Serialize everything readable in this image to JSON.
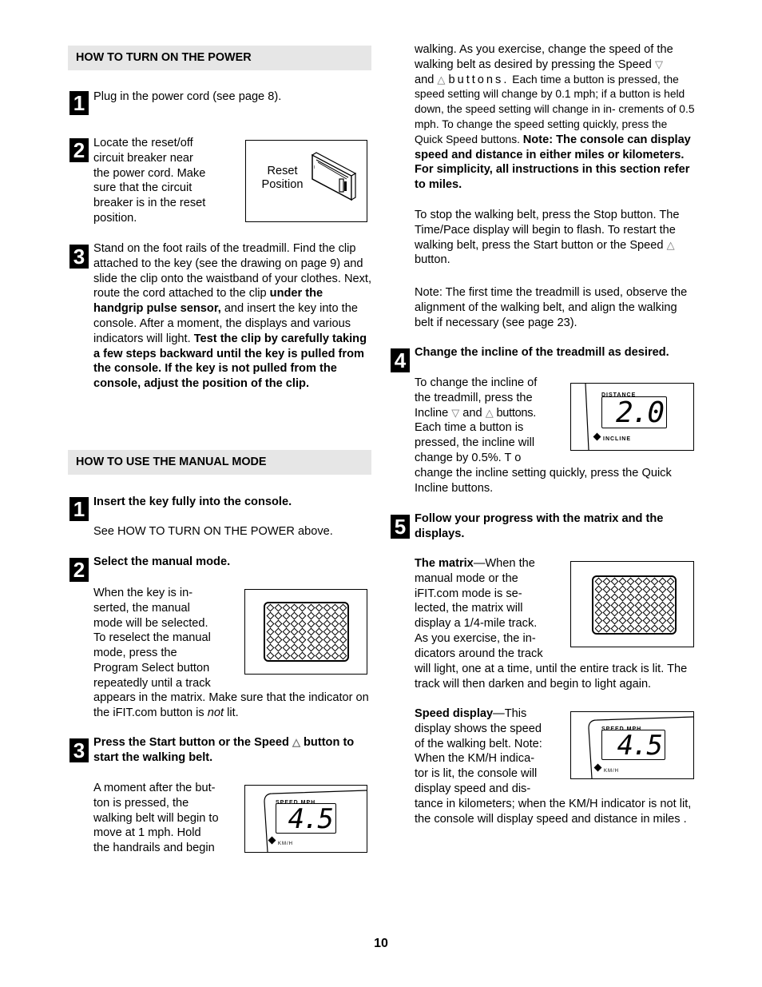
{
  "page_number": "10",
  "left": {
    "power": {
      "heading": "HOW TO TURN ON THE POWER",
      "steps": [
        {
          "n": "1",
          "text": "Plug in the power cord (see page 8)."
        },
        {
          "n": "2",
          "text_lines": [
            "Locate the reset/off",
            "circuit breaker near",
            "the power cord. Make",
            "sure that the circuit",
            "breaker is in the reset",
            "position."
          ],
          "figure": {
            "label_line1": "Reset",
            "label_line2": "Position",
            "icon": "circuit-breaker-icon"
          }
        },
        {
          "n": "3",
          "normal1": "Stand on the foot rails of the treadmill. Find the clip attached to the key (see the drawing on page 9) and slide the clip onto the waistband of your clothes. Next, route the cord attached to the clip ",
          "bold1": "under the handgrip pulse sensor,",
          "normal2": " and insert the key into the console. After a moment, the displays and various indicators will light. ",
          "bold2": "Test the clip by carefully taking a few steps backward until the key is pulled from the console. If the key is not pulled from the console, adjust the position of the clip."
        }
      ]
    },
    "manual": {
      "heading": "HOW TO USE THE MANUAL MODE",
      "steps": [
        {
          "n": "1",
          "title": "Insert the key fully into the console.",
          "text": "See HOW TO TURN ON THE POWER above."
        },
        {
          "n": "2",
          "title": "Select the manual mode.",
          "text_lines": [
            "When the key is in-",
            "serted, the manual",
            "mode will be selected.",
            "To reselect the manual",
            "mode, press the",
            "Program Select button",
            "repeatedly until a track"
          ],
          "text_tail_before": "appears in the matrix. Make sure that the indicator on the iFIT.com button is ",
          "text_tail_italic": "not",
          "text_tail_after": " lit."
        },
        {
          "n": "3",
          "title_before": "Press the Start button or the Speed ",
          "title_arrow": "△",
          "title_after": " button to start the walking belt.",
          "text_lines": [
            "A moment after the but-",
            "ton is pressed, the",
            "walking belt will begin to",
            "move at 1 mph. Hold",
            "the handrails and begin"
          ],
          "display": {
            "label": "SPEED MPH",
            "value": "4.5",
            "indicator": "KM/H"
          }
        }
      ]
    }
  },
  "right": {
    "cont_lines": [
      "walking. As you exercise, change the speed of the",
      "walking belt as desired by pressing the Speed "
    ],
    "arrow_down": "▽",
    "arrow_up": "△",
    "and_word": "and ",
    "buttons_spaced": "buttons.",
    "cont_rest": " Each time a button is pressed, the speed setting will change by 0.1 mph; if a button is held down, the speed setting will change in in- crements of 0.5 mph. To change the speed setting quickly, press the Quick Speed buttons. ",
    "cont_bold": "Note: The console can display speed and distance in either miles or kilometers. For simplicity, all instructions in this section refer to miles.",
    "stop_para_before": "To stop the walking belt, press the Stop button. The Time/Pace display will begin to flash. To restart the walking belt, press the Start button or the Speed ",
    "stop_para_after": " button.",
    "note_para": "Note: The first time the treadmill is used, observe the alignment of the walking belt, and align the walking belt if necessary (see page 23).",
    "step4": {
      "n": "4",
      "title": "Change the incline of the treadmill as desired.",
      "text_lines": [
        "To change the incline of",
        "the treadmill, press the"
      ],
      "incline_word": "Incline ",
      "and_word": " and ",
      "buttons_word": " buttons.",
      "text_lines2": [
        "Each time a button is",
        "pressed, the incline will",
        "change by 0.5%. T o"
      ],
      "text_tail": "change the incline setting quickly, press the Quick Incline buttons.",
      "display": {
        "label": "DISTANCE",
        "value": "2.0",
        "indicator": "INCLINE"
      }
    },
    "step5": {
      "n": "5",
      "title": "Follow your progress with the matrix and the displays.",
      "matrix_title": "The matrix",
      "matrix_lines": [
        "—When the",
        "manual mode or the",
        "iFIT.com mode is se-",
        "lected, the matrix will",
        "display a 1/4-mile track.",
        "As you exercise, the in-",
        "dicators around the track"
      ],
      "matrix_tail": "will light, one at a time, until the entire track is lit. The track will then darken and begin to light again.",
      "speed_title": "Speed display",
      "speed_lines": [
        "—This",
        "display shows the speed",
        "of the walking belt. Note:",
        "When the KM/H indica-",
        "tor is lit, the console will",
        "display speed and dis-"
      ],
      "speed_tail": "tance in kilometers; when the KM/H indicator is not lit, the console will display speed and distance in miles .",
      "display": {
        "label": "SPEED MPH",
        "value": "4.5",
        "indicator": "KM/H"
      }
    }
  }
}
